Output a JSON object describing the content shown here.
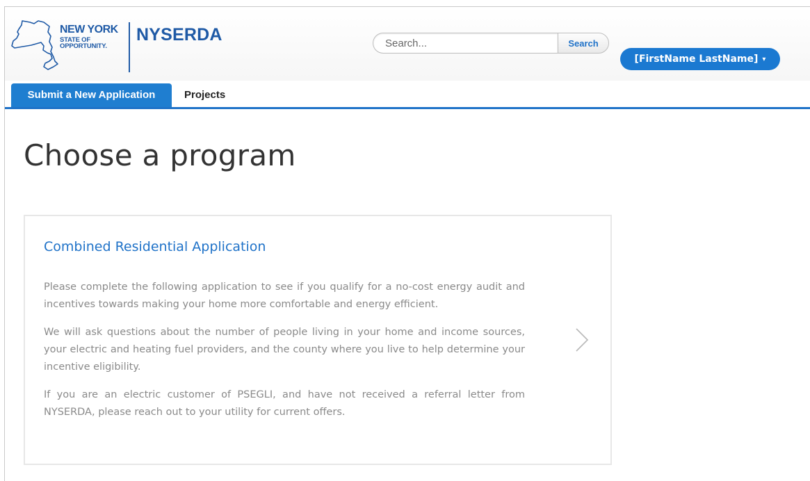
{
  "header": {
    "logo_state_line1": "NEW YORK",
    "logo_state_line2": "STATE OF",
    "logo_state_line3": "OPPORTUNITY.",
    "logo_agency": "NYSERDA",
    "search_placeholder": "Search...",
    "search_button_label": "Search",
    "user_menu_label": "[FirstName LastName]",
    "user_menu_caret": "▾"
  },
  "tabs": [
    {
      "label": "Submit a New Application",
      "active": true
    },
    {
      "label": "Projects",
      "active": false
    }
  ],
  "main": {
    "page_title": "Choose a program",
    "program_card": {
      "title": "Combined Residential Application",
      "paragraphs": [
        "Please complete the following application to see if you qualify for a no-cost energy audit and incentives towards making your home more comfortable and energy efficient.",
        "We will ask questions about the number of people living in your home and income sources, your electric and heating fuel providers, and the county where you live to help determine your incentive eligibility.",
        "If you are an electric customer of PSEGLI, and have not received a referral letter from NYSERDA, please reach out to your utility for current offers."
      ],
      "chevron_icon": "chevron-right-icon"
    }
  },
  "colors": {
    "brand_blue": "#1f5aa6",
    "accent_blue": "#1f72c8",
    "tab_active_bg": "#1f7ed0",
    "user_menu_bg": "#1b79d1",
    "body_text_gray": "#8a8a8a"
  }
}
